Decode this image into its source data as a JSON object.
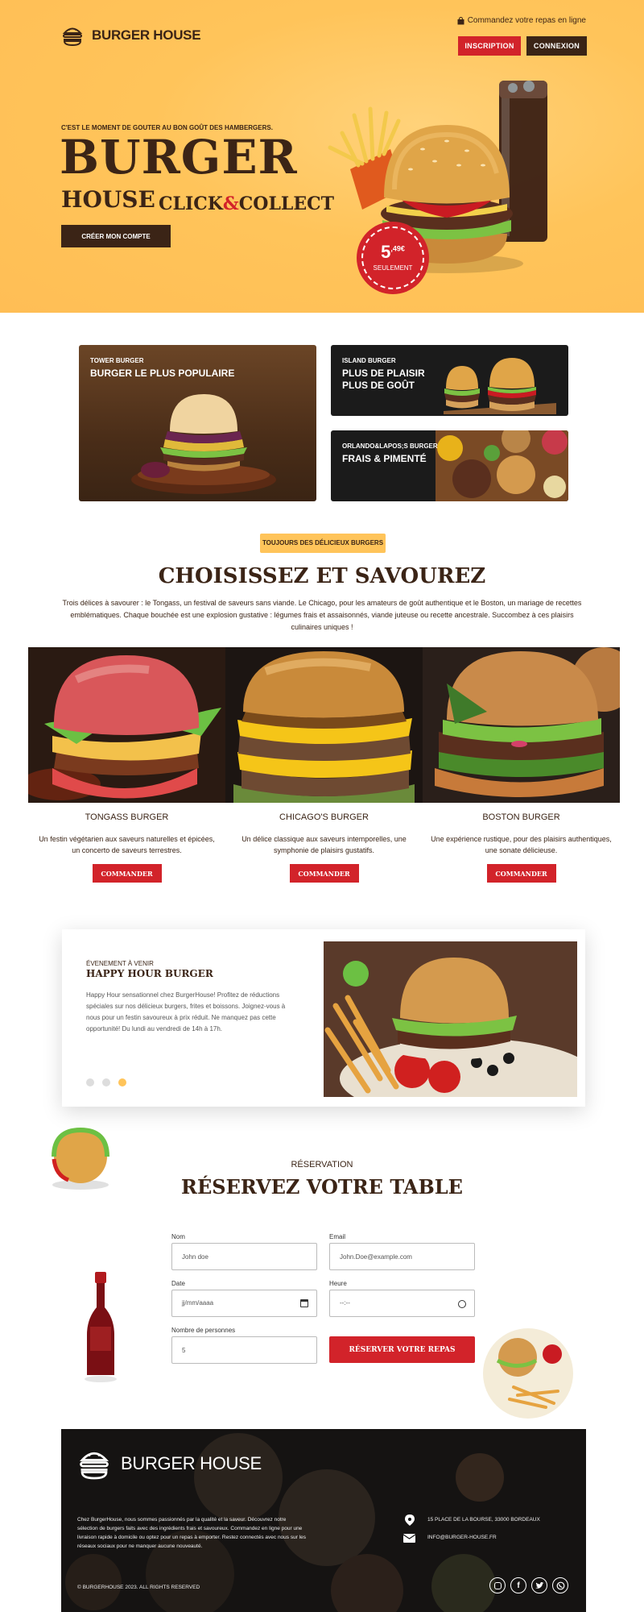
{
  "header": {
    "brand": "BURGER HOUSE",
    "order_online": "Commandez votre repas en ligne",
    "signup_label": "INSCRIPTION",
    "login_label": "CONNEXION"
  },
  "hero": {
    "tagline": "C'EST LE MOMENT DE GOUTER AU BON GOÛT DES HAMBERGERS.",
    "title_line1": "BURGER",
    "title_line2": "HOUSE",
    "title_line3_a": "CLICK",
    "title_line3_amp": "&",
    "title_line3_b": "COLLECT",
    "cta_label": "CRÉER MON COMPTE",
    "price_main": "5",
    "price_cents": ",49€",
    "price_note": "SEULEMENT"
  },
  "promos": [
    {
      "sub": "TOWER BURGER",
      "title": "BURGER LE PLUS POPULAIRE"
    },
    {
      "sub": "ISLAND BURGER",
      "title_line1": "PLUS DE PLAISIR",
      "title_line2": "PLUS DE GOÛT"
    },
    {
      "sub": "ORLANDO&LAPOS;S BURGER",
      "title": "FRAIS & PIMENTÉ"
    }
  ],
  "choose": {
    "pill": "TOUJOURS DES DÉLICIEUX BURGERS",
    "title": "CHOISISSEZ ET SAVOUREZ",
    "intro": "Trois délices à savourer : le Tongass, un festival de saveurs sans viande. Le Chicago, pour les amateurs de goût authentique et le Boston, un mariage de recettes emblématiques. Chaque bouchée est une explosion gustative : légumes frais et assaisonnés, viande juteuse ou recette ancestrale. Succombez à ces plaisirs culinaires uniques !"
  },
  "products": [
    {
      "name": "TONGASS BURGER",
      "desc": "Un festin végétarien aux saveurs naturelles et épicées, un concerto de saveurs terrestres.",
      "button": "COMMANDER"
    },
    {
      "name": "CHICAGO'S BURGER",
      "desc": "Un délice classique aux saveurs intemporelles, une symphonie de plaisirs gustatifs.",
      "button": "COMMANDER"
    },
    {
      "name": "BOSTON BURGER",
      "desc": "Une expérience rustique, pour des plaisirs authentiques, une sonate délicieuse.",
      "button": "COMMANDER"
    }
  ],
  "event": {
    "kicker": "ÉVENEMENT À VENIR",
    "title": "HAPPY HOUR BURGER",
    "text": "Happy Hour sensationnel chez BurgerHouse! Profitez de réductions spéciales sur nos délicieux burgers, frites et boissons. Joignez-vous à nous pour un festin savoureux à prix réduit. Ne manquez pas cette opportunité! Du lundi au vendredi de 14h à 17h.",
    "active_slide": 3
  },
  "reservation": {
    "kicker": "RÉSERVATION",
    "title": "RÉSERVEZ VOTRE TABLE",
    "name_label": "Nom",
    "name_value": "John doe",
    "email_label": "Email",
    "email_value": "John.Doe@example.com",
    "date_label": "Date",
    "date_placeholder": "jj/mm/aaaa",
    "time_label": "Heure",
    "time_placeholder": "--:--",
    "people_label": "Nombre de personnes",
    "people_value": "5",
    "submit_label": "RÉSERVER VOTRE REPAS"
  },
  "footer": {
    "brand": "BURGER HOUSE",
    "about": "Chez BurgerHouse, nous sommes passionnés par la qualité et la saveur. Découvrez notre sélection de burgers faits avec des ingrédients frais et savoureux. Commandez en ligne pour une livraison rapide à domicile ou optez pour un repas à emporter. Restez connectés avec nous sur les réseaux sociaux pour ne manquer aucune nouveauté.",
    "copyright": "© BURGERHOUSE 2023. ALL RIGHTS RESERVED",
    "address": "15 PLACE DE LA BOURSE, 33000 BORDEAUX",
    "email": "INFO@BURGER-HOUSE.FR"
  },
  "colors": {
    "accent_red": "#d2232a",
    "brown": "#3b2416",
    "yellow": "#ffc45a"
  }
}
